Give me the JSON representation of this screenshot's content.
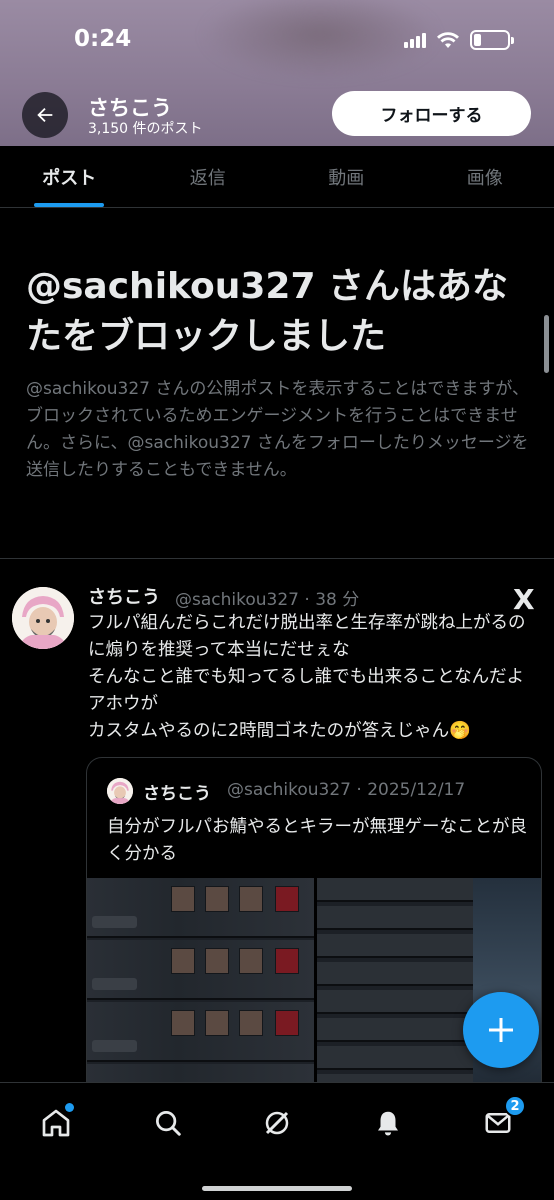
{
  "status_bar": {
    "time": "0:24"
  },
  "header": {
    "profile_name": "さちこう",
    "post_count": "3,150 件のポスト",
    "follow_label": "フォローする"
  },
  "tabs": [
    {
      "label": "ポスト",
      "active": true
    },
    {
      "label": "返信",
      "active": false
    },
    {
      "label": "動画",
      "active": false
    },
    {
      "label": "画像",
      "active": false
    }
  ],
  "blocked": {
    "title": "@sachikou327 さんはあなたをブロックしました",
    "description": "@sachikou327 さんの公開ポストを表示することはできますが、ブロックされているためエンゲージメントを行うことはできません。さらに、@sachikou327 さんをフォローしたりメッセージを送信したりすることもできません。"
  },
  "post": {
    "name": "さちこう",
    "meta": "@sachikou327 · 38 分",
    "source_logo": "X",
    "text": "フルパ組んだらこれだけ脱出率と生存率が跳ね上がるのに煽りを推奨って本当にだせぇな\nそんなこと誰でも知ってるし誰でも出来ることなんだよアホウが\nカスタムやるのに2時間ゴネたのが答えじゃん🤭",
    "quote": {
      "name": "さちこう",
      "meta": "@sachikou327 · 2025/12/17",
      "text": "自分がフルパお鯖やるとキラーが無理ゲーなことが良く分かる"
    }
  },
  "bottom_nav": {
    "notifications_badge": "2"
  },
  "colors": {
    "accent": "#1d9bf0",
    "muted": "#71767b",
    "background": "#000000"
  }
}
